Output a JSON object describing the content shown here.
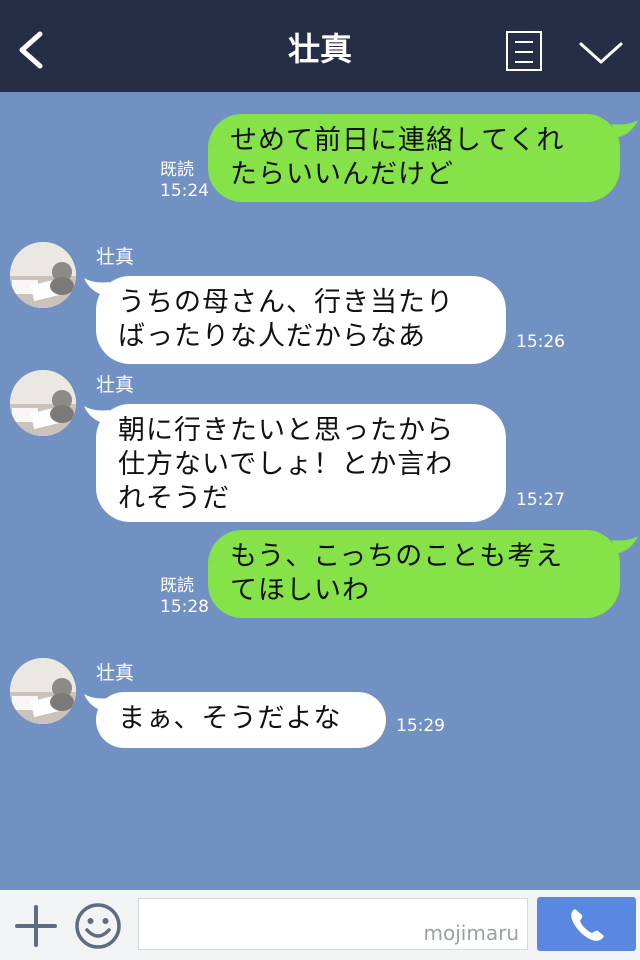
{
  "header": {
    "title": "壮真",
    "back_icon": "back-chevron-icon",
    "menu_icon": "menu-list-icon",
    "dropdown_icon": "chevron-down-icon"
  },
  "colors": {
    "header_bg": "#252e44",
    "chat_bg": "#7191c2",
    "outgoing_bubble": "#86e249",
    "incoming_bubble": "#ffffff",
    "call_button": "#5a88e0"
  },
  "messages": [
    {
      "direction": "out",
      "lines": [
        "せめて前日に連絡してくれ",
        "たらいいんだけど"
      ],
      "read": "既読",
      "time": "15:24"
    },
    {
      "direction": "in",
      "sender": "壮真",
      "lines": [
        "うちの母さん、行き当たり",
        "ばったりな人だからなあ"
      ],
      "time": "15:26"
    },
    {
      "direction": "in",
      "sender": "壮真",
      "lines": [
        "朝に行きたいと思ったから",
        "仕方ないでしょ！とか言わ",
        "れそうだ"
      ],
      "time": "15:27"
    },
    {
      "direction": "out",
      "lines": [
        "もう、こっちのことも考え",
        "てほしいわ"
      ],
      "read": "既読",
      "time": "15:28"
    },
    {
      "direction": "in",
      "sender": "壮真",
      "lines": [
        "まぁ、そうだよな"
      ],
      "time": "15:29"
    }
  ],
  "footer": {
    "input_value": "",
    "watermark": "mojimaru",
    "plus_icon": "plus-icon",
    "emoji_icon": "smile-icon",
    "call_icon": "phone-icon"
  }
}
